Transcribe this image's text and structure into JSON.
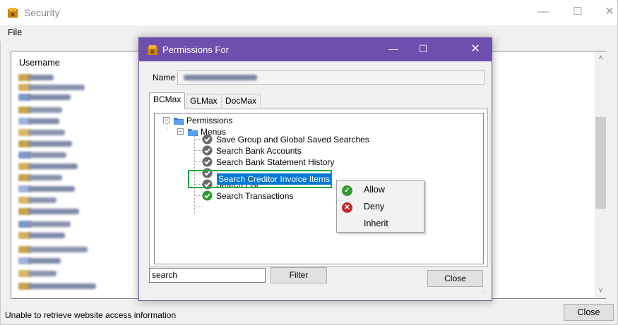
{
  "main_window": {
    "title": "Security",
    "menu": {
      "file": "File"
    },
    "user_list": {
      "header": "Username"
    },
    "status_text": "Unable to retrieve website access information",
    "close_label": "Close"
  },
  "dialog": {
    "title": "Permissions For",
    "name_label": "Name",
    "tabs": [
      "BCMax",
      "GLMax",
      "DocMax"
    ],
    "tree": {
      "root": "Permissions",
      "menus": "Menus",
      "items": [
        "Save Group and Global Saved Searches",
        "Search Bank Accounts",
        "Search Bank Statement History",
        "Search Creditor Invoice Items",
        "Search List",
        "Search Transactions"
      ]
    },
    "search_value": "search",
    "filter_label": "Filter",
    "close_label": "Close"
  },
  "context_menu": {
    "items": [
      {
        "label": "Allow",
        "icon": "allow-check-icon"
      },
      {
        "label": "Deny",
        "icon": "deny-x-icon"
      },
      {
        "label": "Inherit",
        "icon": ""
      }
    ]
  },
  "colors": {
    "dialog_titlebar": "#6f4fae",
    "selection": "#0078d7",
    "highlight_box": "#22a84a",
    "allow_green": "#2e9b2e",
    "deny_red": "#c62828"
  }
}
